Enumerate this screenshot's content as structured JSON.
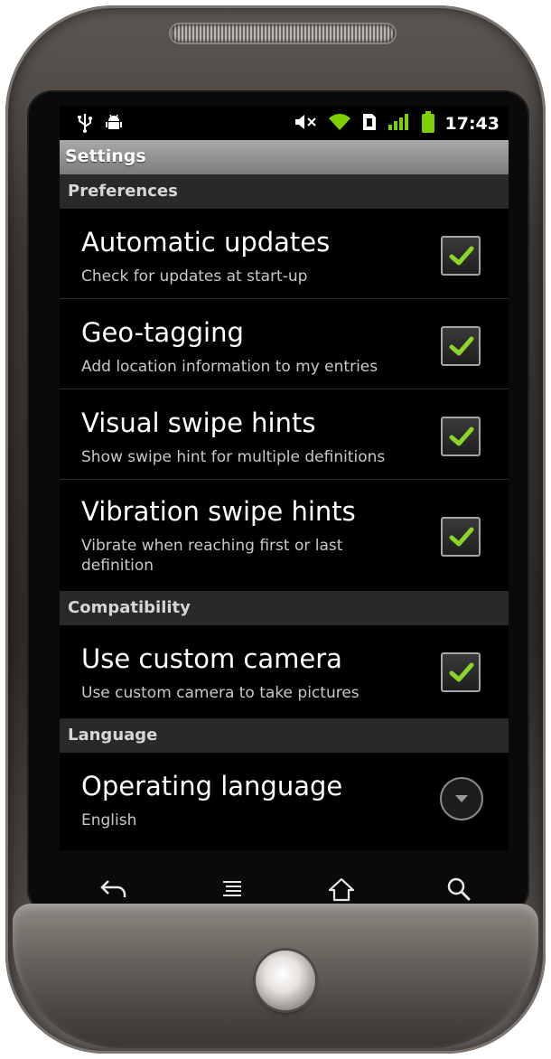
{
  "status_bar": {
    "time": "17:43",
    "icons": [
      "usb-icon",
      "android-debug-icon",
      "mute-icon",
      "wifi-icon",
      "sim-icon",
      "signal-icon",
      "battery-icon"
    ]
  },
  "title_bar": {
    "title": "Settings"
  },
  "sections": {
    "preferences": {
      "label": "Preferences"
    },
    "compatibility": {
      "label": "Compatibility"
    },
    "language": {
      "label": "Language"
    }
  },
  "items": {
    "automatic_updates": {
      "title": "Automatic updates",
      "summary": "Check for updates at start-up",
      "checked": true
    },
    "geo_tagging": {
      "title": "Geo-tagging",
      "summary": "Add location information to my entries",
      "checked": true
    },
    "visual_swipe_hints": {
      "title": "Visual swipe hints",
      "summary": "Show swipe hint for multiple definitions",
      "checked": true
    },
    "vibration_swipe_hints": {
      "title": "Vibration swipe hints",
      "summary": "Vibrate when reaching first or last definition",
      "checked": true
    },
    "use_custom_camera": {
      "title": "Use custom camera",
      "summary": "Use custom camera to take pictures",
      "checked": true
    },
    "operating_language": {
      "title": "Operating language",
      "summary": "English"
    }
  },
  "nav_keys": [
    "back-icon",
    "menu-icon",
    "home-icon",
    "search-icon"
  ],
  "colors": {
    "check_green": "#8bd42a",
    "signal_green": "#7fd000",
    "section_bg": "#292929",
    "titlebar_gray": "#8e8e8e"
  }
}
